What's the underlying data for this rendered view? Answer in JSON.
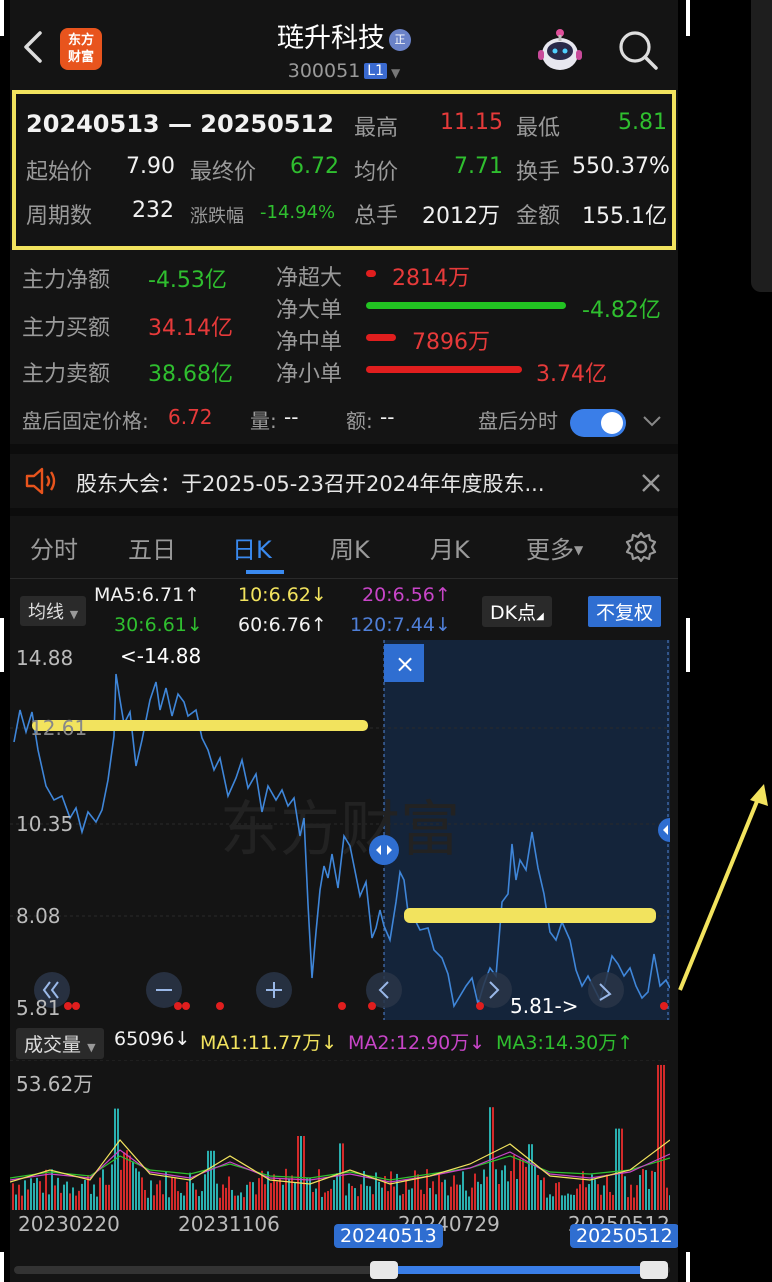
{
  "header": {
    "title": "琏升科技",
    "title_badge": "正",
    "code": "300051",
    "level": "L1",
    "logo_line1": "东方",
    "logo_line2": "财富"
  },
  "stats": {
    "range": "20240513 — 20250512",
    "high_label": "最高",
    "high": "11.15",
    "low_label": "最低",
    "low": "5.81",
    "start_label": "起始价",
    "start": "7.90",
    "end_label": "最终价",
    "end": "6.72",
    "avg_label": "均价",
    "avg": "7.71",
    "turnover_label": "换手",
    "turnover": "550.37%",
    "period_label": "周期数",
    "period": "232",
    "change_label": "涨跌幅",
    "change": "-14.94%",
    "volume_label": "总手",
    "volume": "2012万",
    "amount_label": "金额",
    "amount": "155.1亿"
  },
  "flow": {
    "net_label": "主力净额",
    "net": "-4.53亿",
    "buy_label": "主力买额",
    "buy": "34.14亿",
    "sell_label": "主力卖额",
    "sell": "38.68亿",
    "super_label": "净超大",
    "super": "2814万",
    "large_label": "净大单",
    "large": "-4.82亿",
    "medium_label": "净中单",
    "medium": "7896万",
    "small_label": "净小单",
    "small": "3.74亿"
  },
  "after_hours": {
    "price_label": "盘后固定价格:",
    "price": "6.72",
    "vol_label": "量:",
    "vol": "--",
    "amt_label": "额:",
    "amt": "--",
    "toggle_label": "盘后分时"
  },
  "notice": {
    "text": "股东大会：于2025-05-23召开2024年年度股东..."
  },
  "tabs": [
    "分时",
    "五日",
    "日K",
    "周K",
    "月K",
    "更多"
  ],
  "indicators": {
    "ma_chip": "均线",
    "ma5": "MA5:6.71↑",
    "ma10": "10:6.62↓",
    "ma20": "20:6.56↑",
    "ma30": "30:6.61↓",
    "ma60": "60:6.76↑",
    "ma120": "120:7.44↓",
    "dk": "DK点",
    "adjust": "不复权"
  },
  "chart": {
    "y_labels": [
      "14.88",
      "12.61",
      "10.35",
      "8.08",
      "5.81"
    ],
    "max_note": "<-14.88",
    "min_note": "5.81->",
    "close_x": "×",
    "watermark": "东方财富",
    "colors": {
      "price_line": "#3f86d9",
      "highlight": "#f2e35e",
      "selection": "#14243a"
    }
  },
  "volume": {
    "chip": "成交量",
    "current": "65096↓",
    "ma1": "MA1:11.77万↓",
    "ma2": "MA2:12.90万↓",
    "ma3": "MA3:14.30万↑",
    "max": "53.62万"
  },
  "dates": {
    "d1": "20230220",
    "d2": "20231106",
    "d3": "20240729",
    "d4": "20250512",
    "sel_start": "20240513",
    "sel_end": "20250512"
  }
}
